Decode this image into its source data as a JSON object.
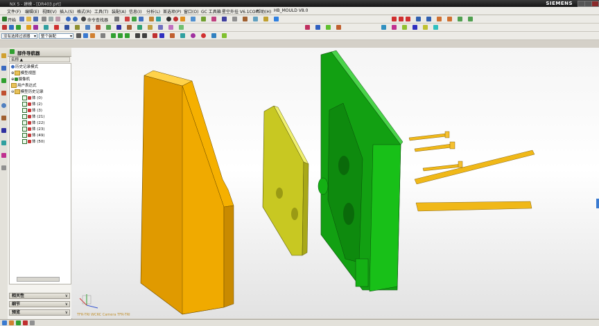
{
  "window": {
    "title": "NX 5 - 建模 - [DR403.prt]",
    "brand": "SIEMENS"
  },
  "menu": [
    "文件(F)",
    "编辑(E)",
    "视图(V)",
    "插入(S)",
    "格式(R)",
    "工具(T)",
    "装配(A)",
    "信息(I)",
    "分析(L)",
    "首选项(P)",
    "窗口(O)",
    "GC 工具箱",
    "星空外挂 V6.1COF",
    "帮助(H)",
    "HB_MOULD V8.0"
  ],
  "toolbar": {
    "start_label": "开始",
    "command_finder": "命令查找器",
    "selection_filter": "没有选择过滤器",
    "assembly_scope": "整个装配"
  },
  "navigator": {
    "title": "部件导航器",
    "column_name": "名称",
    "items": [
      {
        "label": "历史记录模式",
        "indent": 0
      },
      {
        "label": "模型视图",
        "indent": 0
      },
      {
        "label": "摄像机",
        "indent": 0
      },
      {
        "label": "用户表达式",
        "indent": 0
      },
      {
        "label": "模型历史记录",
        "indent": 0
      },
      {
        "label": "体 (0)",
        "indent": 1
      },
      {
        "label": "体 (2)",
        "indent": 1
      },
      {
        "label": "体 (3)",
        "indent": 1
      },
      {
        "label": "体 (21)",
        "indent": 1
      },
      {
        "label": "体 (22)",
        "indent": 1
      },
      {
        "label": "体 (23)",
        "indent": 1
      },
      {
        "label": "体 (49)",
        "indent": 1
      },
      {
        "label": "体 (50)",
        "indent": 1
      }
    ],
    "panels": [
      "相关性",
      "细节",
      "预览"
    ]
  },
  "viewport": {
    "camera_label": "TFR-TRI WCRC Camera TFR-TRI"
  },
  "colors": {
    "mold_orange": "#f5b000",
    "plate_yellow": "#d6d62a",
    "core_green": "#19b419",
    "pin_orange": "#f0b818"
  }
}
